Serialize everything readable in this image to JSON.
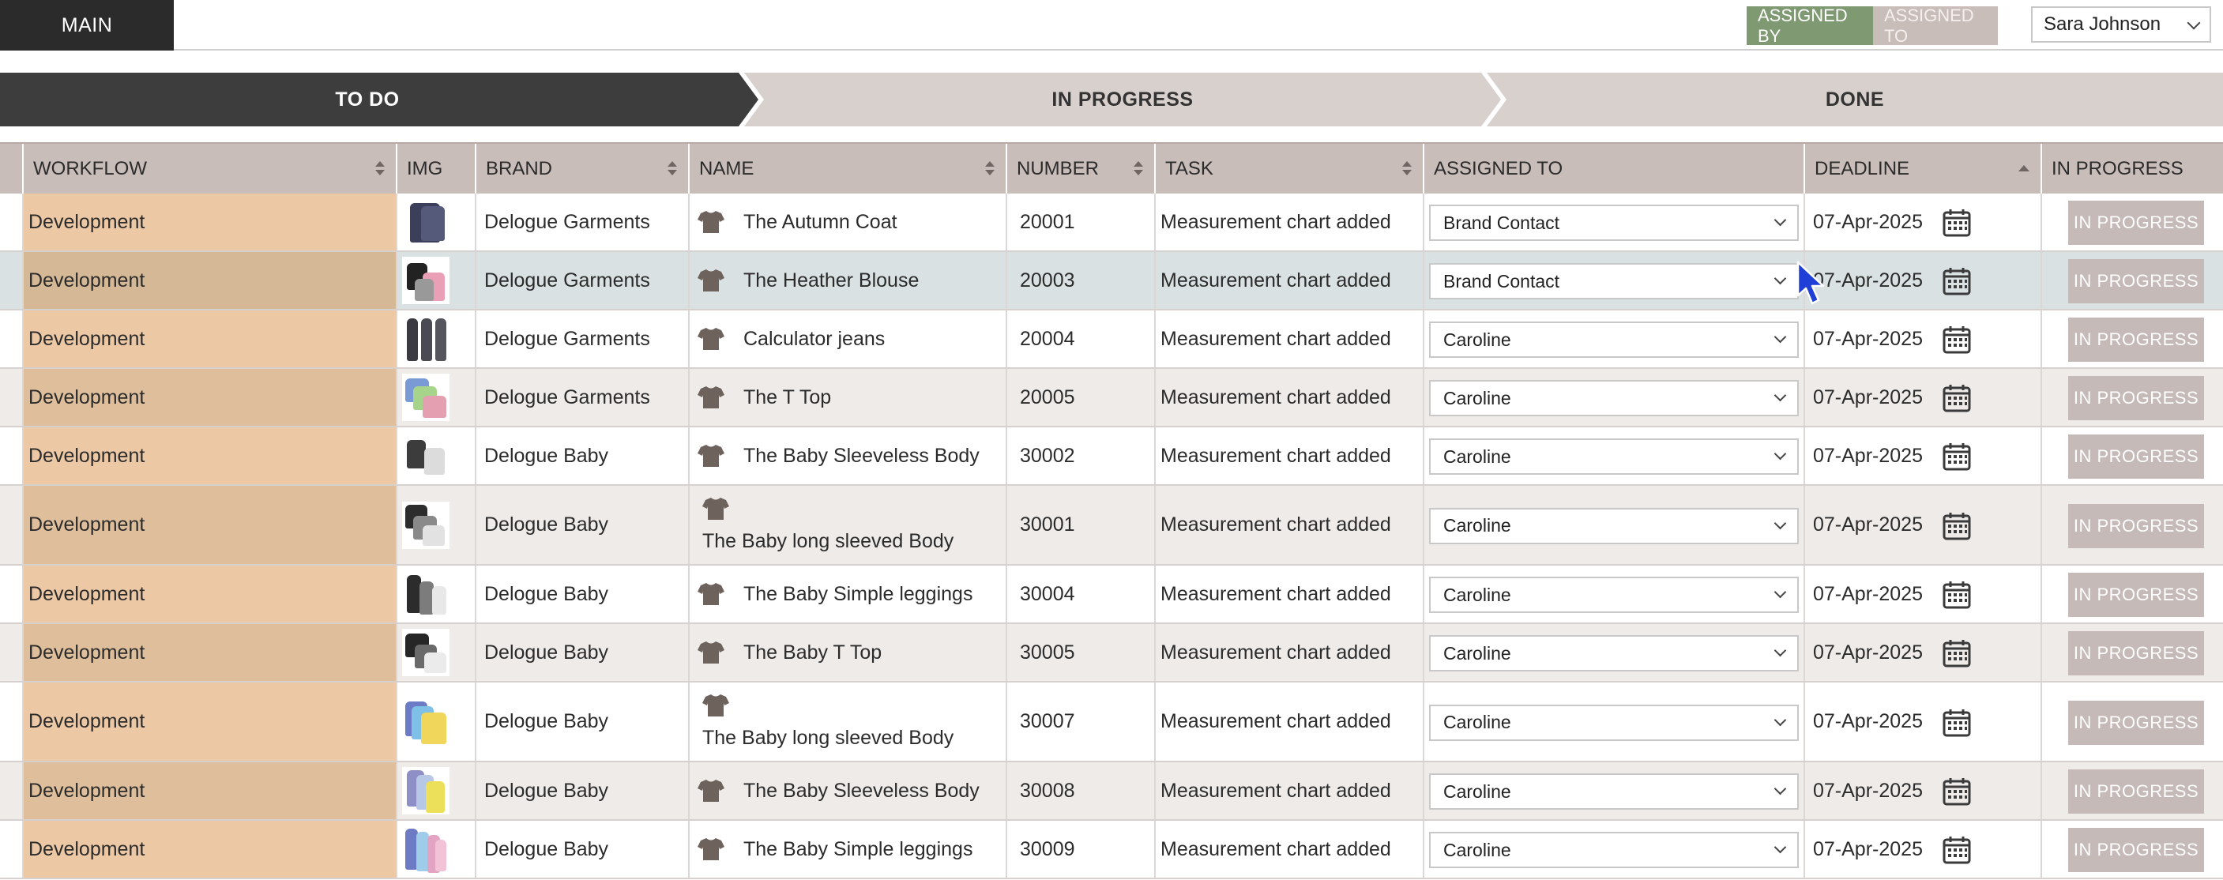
{
  "topbar": {
    "main_tab": "MAIN",
    "assigned_by": "ASSIGNED BY",
    "assigned_to": "ASSIGNED TO",
    "user": "Sara Johnson"
  },
  "stages": {
    "todo": "TO DO",
    "in_progress": "IN PROGRESS",
    "done": "DONE"
  },
  "columns": {
    "workflow": "WORKFLOW",
    "img": "IMG",
    "brand": "BRAND",
    "name": "NAME",
    "number": "NUMBER",
    "task": "TASK",
    "assigned_to": "ASSIGNED TO",
    "deadline": "DEADLINE",
    "in_progress": "IN PROGRESS"
  },
  "rows": [
    {
      "workflow": "Development",
      "brand": "Delogue Garments",
      "name": "The Autumn Coat",
      "number": "20001",
      "task": "Measurement chart added",
      "assigned_to": "Brand Contact",
      "deadline": "07-Apr-2025",
      "action": "IN PROGRESS",
      "thumb": "coat"
    },
    {
      "workflow": "Development",
      "brand": "Delogue Garments",
      "name": "The Heather Blouse",
      "number": "20003",
      "task": "Measurement chart added",
      "assigned_to": "Brand Contact",
      "deadline": "07-Apr-2025",
      "action": "IN PROGRESS",
      "thumb": "blouse"
    },
    {
      "workflow": "Development",
      "brand": "Delogue Garments",
      "name": "Calculator jeans",
      "number": "20004",
      "task": "Measurement chart added",
      "assigned_to": "Caroline",
      "deadline": "07-Apr-2025",
      "action": "IN PROGRESS",
      "thumb": "jeans"
    },
    {
      "workflow": "Development",
      "brand": "Delogue Garments",
      "name": "The T Top",
      "number": "20005",
      "task": "Measurement chart added",
      "assigned_to": "Caroline",
      "deadline": "07-Apr-2025",
      "action": "IN PROGRESS",
      "thumb": "tees"
    },
    {
      "workflow": "Development",
      "brand": "Delogue Baby",
      "name": "The Baby Sleeveless Body",
      "number": "30002",
      "task": "Measurement chart added",
      "assigned_to": "Caroline",
      "deadline": "07-Apr-2025",
      "action": "IN PROGRESS",
      "thumb": "body"
    },
    {
      "workflow": "Development",
      "brand": "Delogue Baby",
      "name": "The Baby long sleeved Body",
      "number": "30001",
      "task": "Measurement chart added",
      "assigned_to": "Caroline",
      "deadline": "07-Apr-2025",
      "action": "IN PROGRESS",
      "thumb": "longbody"
    },
    {
      "workflow": "Development",
      "brand": "Delogue Baby",
      "name": "The Baby Simple leggings",
      "number": "30004",
      "task": "Measurement chart added",
      "assigned_to": "Caroline",
      "deadline": "07-Apr-2025",
      "action": "IN PROGRESS",
      "thumb": "leggings"
    },
    {
      "workflow": "Development",
      "brand": "Delogue Baby",
      "name": "The Baby T Top",
      "number": "30005",
      "task": "Measurement chart added",
      "assigned_to": "Caroline",
      "deadline": "07-Apr-2025",
      "action": "IN PROGRESS",
      "thumb": "babytee"
    },
    {
      "workflow": "Development",
      "brand": "Delogue Baby",
      "name": "The Baby long sleeved Body",
      "number": "30007",
      "task": "Measurement chart added",
      "assigned_to": "Caroline",
      "deadline": "07-Apr-2025",
      "action": "IN PROGRESS",
      "thumb": "colorbody"
    },
    {
      "workflow": "Development",
      "brand": "Delogue Baby",
      "name": "The Baby Sleeveless Body",
      "number": "30008",
      "task": "Measurement chart added",
      "assigned_to": "Caroline",
      "deadline": "07-Apr-2025",
      "action": "IN PROGRESS",
      "thumb": "colorbody2"
    },
    {
      "workflow": "Development",
      "brand": "Delogue Baby",
      "name": "The Baby Simple leggings",
      "number": "30009",
      "task": "Measurement chart added",
      "assigned_to": "Caroline",
      "deadline": "07-Apr-2025",
      "action": "IN PROGRESS",
      "thumb": "colorleg"
    }
  ],
  "colors": {
    "accent_green": "#7f9a72",
    "header_bg": "#c9bdb9",
    "workflow_bg": "#ecc8a5",
    "button_bg": "#c5bab7",
    "dark": "#3d3d3d"
  },
  "icons": {
    "garment": "tshirt-icon",
    "calendar": "calendar-icon",
    "cursor": "mouse-cursor-icon"
  }
}
